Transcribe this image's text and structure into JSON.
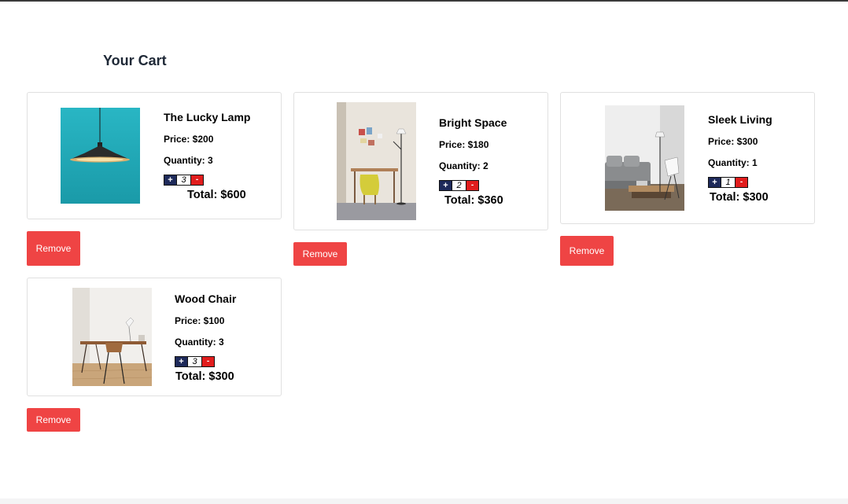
{
  "cart": {
    "title": "Your Cart",
    "remove_label": "Remove",
    "items": [
      {
        "name": "The Lucky Lamp",
        "price": "Price: $200",
        "quantity": "Quantity: 3",
        "qty": "3",
        "plus": "+",
        "minus": "-",
        "total": "Total: $600"
      },
      {
        "name": "Bright Space",
        "price": "Price: $180",
        "quantity": "Quantity: 2",
        "qty": "2",
        "plus": "+",
        "minus": "-",
        "total": "Total: $360"
      },
      {
        "name": "Sleek Living",
        "price": "Price: $300",
        "quantity": "Quantity: 1",
        "qty": "1",
        "plus": "+",
        "minus": "-",
        "total": "Total: $300"
      },
      {
        "name": "Wood Chair",
        "price": "Price: $100",
        "quantity": "Quantity: 3",
        "qty": "3",
        "plus": "+",
        "minus": "-",
        "total": "Total: $300"
      }
    ]
  },
  "colors": {
    "remove_button": "#ef4444",
    "qty_plus": "#1e2a5a",
    "qty_minus": "#e11d1d",
    "title": "#1f2937"
  }
}
